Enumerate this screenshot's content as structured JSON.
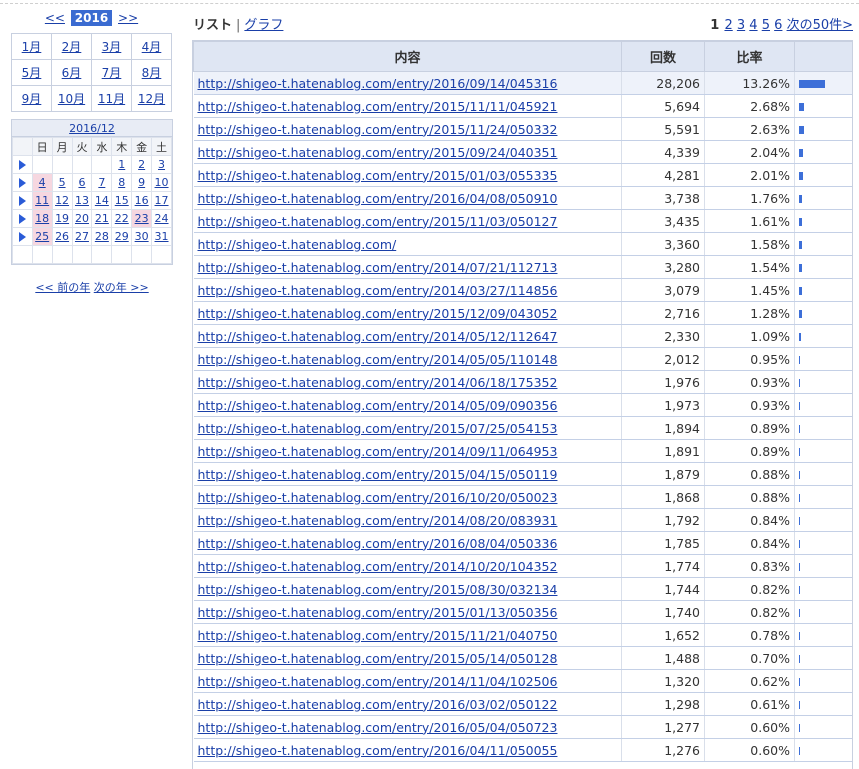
{
  "year_nav": {
    "prev": "<<",
    "year": "2016",
    "next": ">>"
  },
  "months": [
    [
      "1月",
      "2月",
      "3月",
      "4月"
    ],
    [
      "5月",
      "6月",
      "7月",
      "8月"
    ],
    [
      "9月",
      "10月",
      "11月",
      "12月"
    ]
  ],
  "calendar": {
    "title": "2016/12",
    "weekdays": [
      "日",
      "月",
      "火",
      "水",
      "木",
      "金",
      "土"
    ],
    "weeks": [
      [
        "",
        "",
        "",
        "",
        "1",
        "2",
        "3"
      ],
      [
        "4",
        "5",
        "6",
        "7",
        "8",
        "9",
        "10"
      ],
      [
        "11",
        "12",
        "13",
        "14",
        "15",
        "16",
        "17"
      ],
      [
        "18",
        "19",
        "20",
        "21",
        "22",
        "23",
        "24"
      ],
      [
        "25",
        "26",
        "27",
        "28",
        "29",
        "30",
        "31"
      ],
      [
        "",
        "",
        "",
        "",
        "",
        "",
        ""
      ]
    ],
    "highlighted": [
      "4",
      "11",
      "18",
      "23",
      "25"
    ]
  },
  "year_links": {
    "prev": "<< 前の年",
    "next": "次の年 >>"
  },
  "view_tabs": {
    "list": "リスト",
    "separator": "|",
    "graph": "グラフ"
  },
  "pager": {
    "current": "1",
    "pages": [
      "2",
      "3",
      "4",
      "5",
      "6"
    ],
    "next": "次の50件>"
  },
  "table": {
    "headers": {
      "content": "内容",
      "count": "回数",
      "rate": "比率",
      "bar": ""
    },
    "rows": [
      {
        "url": "http://shigeo-t.hatenablog.com/entry/2016/09/14/045316",
        "count": "28,206",
        "rate": "13.26%",
        "pct": 13.26
      },
      {
        "url": "http://shigeo-t.hatenablog.com/entry/2015/11/11/045921",
        "count": "5,694",
        "rate": "2.68%",
        "pct": 2.68
      },
      {
        "url": "http://shigeo-t.hatenablog.com/entry/2015/11/24/050332",
        "count": "5,591",
        "rate": "2.63%",
        "pct": 2.63
      },
      {
        "url": "http://shigeo-t.hatenablog.com/entry/2015/09/24/040351",
        "count": "4,339",
        "rate": "2.04%",
        "pct": 2.04
      },
      {
        "url": "http://shigeo-t.hatenablog.com/entry/2015/01/03/055335",
        "count": "4,281",
        "rate": "2.01%",
        "pct": 2.01
      },
      {
        "url": "http://shigeo-t.hatenablog.com/entry/2016/04/08/050910",
        "count": "3,738",
        "rate": "1.76%",
        "pct": 1.76
      },
      {
        "url": "http://shigeo-t.hatenablog.com/entry/2015/11/03/050127",
        "count": "3,435",
        "rate": "1.61%",
        "pct": 1.61
      },
      {
        "url": "http://shigeo-t.hatenablog.com/",
        "count": "3,360",
        "rate": "1.58%",
        "pct": 1.58
      },
      {
        "url": "http://shigeo-t.hatenablog.com/entry/2014/07/21/112713",
        "count": "3,280",
        "rate": "1.54%",
        "pct": 1.54
      },
      {
        "url": "http://shigeo-t.hatenablog.com/entry/2014/03/27/114856",
        "count": "3,079",
        "rate": "1.45%",
        "pct": 1.45
      },
      {
        "url": "http://shigeo-t.hatenablog.com/entry/2015/12/09/043052",
        "count": "2,716",
        "rate": "1.28%",
        "pct": 1.28
      },
      {
        "url": "http://shigeo-t.hatenablog.com/entry/2014/05/12/112647",
        "count": "2,330",
        "rate": "1.09%",
        "pct": 1.09
      },
      {
        "url": "http://shigeo-t.hatenablog.com/entry/2014/05/05/110148",
        "count": "2,012",
        "rate": "0.95%",
        "pct": 0.95
      },
      {
        "url": "http://shigeo-t.hatenablog.com/entry/2014/06/18/175352",
        "count": "1,976",
        "rate": "0.93%",
        "pct": 0.93
      },
      {
        "url": "http://shigeo-t.hatenablog.com/entry/2014/05/09/090356",
        "count": "1,973",
        "rate": "0.93%",
        "pct": 0.93
      },
      {
        "url": "http://shigeo-t.hatenablog.com/entry/2015/07/25/054153",
        "count": "1,894",
        "rate": "0.89%",
        "pct": 0.89
      },
      {
        "url": "http://shigeo-t.hatenablog.com/entry/2014/09/11/064953",
        "count": "1,891",
        "rate": "0.89%",
        "pct": 0.89
      },
      {
        "url": "http://shigeo-t.hatenablog.com/entry/2015/04/15/050119",
        "count": "1,879",
        "rate": "0.88%",
        "pct": 0.88
      },
      {
        "url": "http://shigeo-t.hatenablog.com/entry/2016/10/20/050023",
        "count": "1,868",
        "rate": "0.88%",
        "pct": 0.88
      },
      {
        "url": "http://shigeo-t.hatenablog.com/entry/2014/08/20/083931",
        "count": "1,792",
        "rate": "0.84%",
        "pct": 0.84
      },
      {
        "url": "http://shigeo-t.hatenablog.com/entry/2016/08/04/050336",
        "count": "1,785",
        "rate": "0.84%",
        "pct": 0.84
      },
      {
        "url": "http://shigeo-t.hatenablog.com/entry/2014/10/20/104352",
        "count": "1,774",
        "rate": "0.83%",
        "pct": 0.83
      },
      {
        "url": "http://shigeo-t.hatenablog.com/entry/2015/08/30/032134",
        "count": "1,744",
        "rate": "0.82%",
        "pct": 0.82
      },
      {
        "url": "http://shigeo-t.hatenablog.com/entry/2015/01/13/050356",
        "count": "1,740",
        "rate": "0.82%",
        "pct": 0.82
      },
      {
        "url": "http://shigeo-t.hatenablog.com/entry/2015/11/21/040750",
        "count": "1,652",
        "rate": "0.78%",
        "pct": 0.78
      },
      {
        "url": "http://shigeo-t.hatenablog.com/entry/2015/05/14/050128",
        "count": "1,488",
        "rate": "0.70%",
        "pct": 0.7
      },
      {
        "url": "http://shigeo-t.hatenablog.com/entry/2014/11/04/102506",
        "count": "1,320",
        "rate": "0.62%",
        "pct": 0.62
      },
      {
        "url": "http://shigeo-t.hatenablog.com/entry/2016/03/02/050122",
        "count": "1,298",
        "rate": "0.61%",
        "pct": 0.61
      },
      {
        "url": "http://shigeo-t.hatenablog.com/entry/2016/05/04/050723",
        "count": "1,277",
        "rate": "0.60%",
        "pct": 0.6
      },
      {
        "url": "http://shigeo-t.hatenablog.com/entry/2016/04/11/050055",
        "count": "1,276",
        "rate": "0.60%",
        "pct": 0.6
      }
    ]
  },
  "colors": {
    "accent": "#3a6bd1",
    "bar": "#3d6fd8",
    "link": "#1a3fa8",
    "header_bg": "#dfe6f3",
    "highlight_day": "#f6d7e0"
  }
}
